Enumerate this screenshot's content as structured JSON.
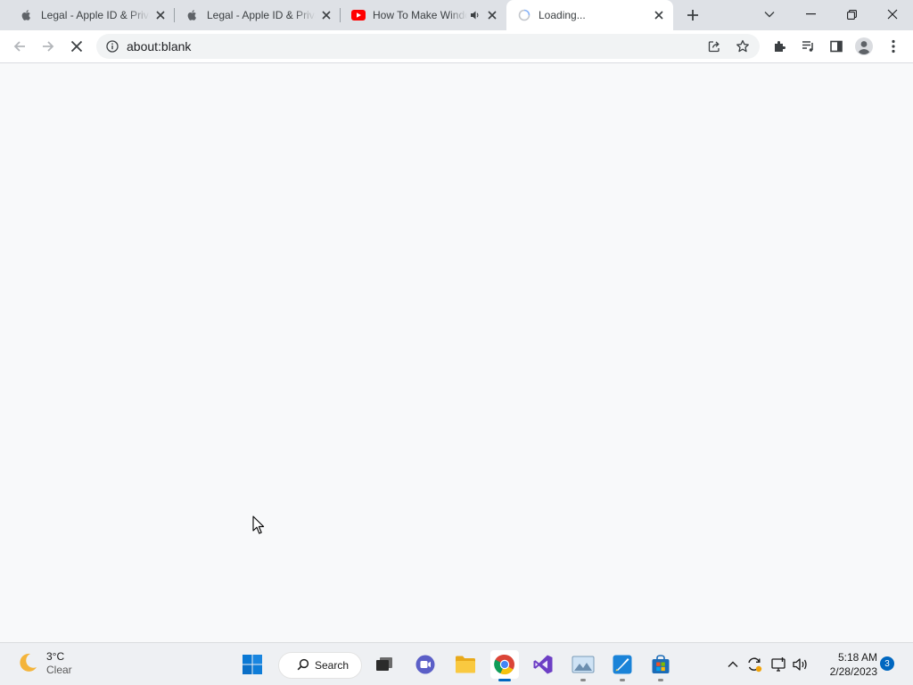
{
  "tabs": [
    {
      "title": "Legal - Apple ID & Privacy",
      "favicon": "apple-icon"
    },
    {
      "title": "Legal - Apple ID & Privacy",
      "favicon": "apple-icon"
    },
    {
      "title": "How To Make Windows",
      "favicon": "youtube-icon",
      "audio": true
    },
    {
      "title": "Loading...",
      "favicon": "loading-spinner-icon",
      "active": true
    }
  ],
  "toolbar": {
    "url": "about:blank"
  },
  "taskbar": {
    "weather_temp": "3°C",
    "weather_condition": "Clear",
    "search_label": "Search",
    "time": "5:18 AM",
    "date": "2/28/2023",
    "notification_count": "3"
  },
  "colors": {
    "tabstrip": "#dee1e6",
    "toolbar": "#ffffff",
    "page": "#f8f9fa",
    "taskbar": "#eef0f3",
    "accent": "#0067c0"
  }
}
